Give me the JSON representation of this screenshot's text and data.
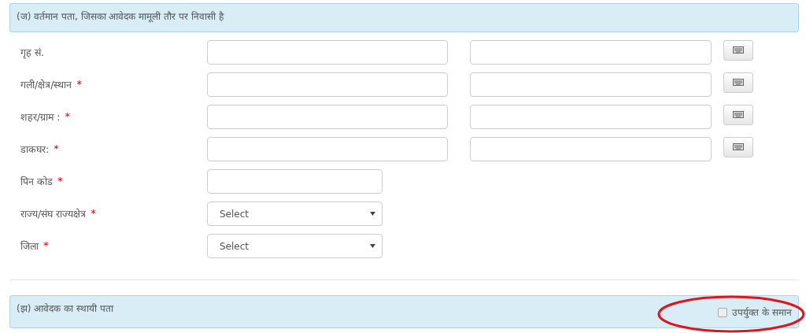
{
  "section_current": {
    "title": "(ज) वर्तमान पता, जिसका आवेदक मामूली तौर पर निवासी है"
  },
  "fields": [
    {
      "kind": "double",
      "label": "गृह सं."
    },
    {
      "kind": "double",
      "label": "गली/क्षेत्र/स्थान",
      "required_mark": "*"
    },
    {
      "kind": "double",
      "label": "शहर/ग्राम :",
      "required_mark": "*"
    },
    {
      "kind": "double",
      "label": "डाकघर:",
      "required_mark": "*"
    },
    {
      "kind": "single",
      "label": "पिन कोड",
      "required_mark": "*"
    },
    {
      "kind": "select",
      "label": "राज्य/संघ राज्यक्षेत्र",
      "required_mark": "*",
      "value": "Select"
    },
    {
      "kind": "select",
      "label": "जिला",
      "required_mark": "*",
      "value": "Select"
    }
  ],
  "section_permanent": {
    "title": "(झ) आवेदक का स्थायी पता",
    "same_as_above": {
      "label": "उपर्युक्त के समान",
      "checked": false
    },
    "highlighted": true
  }
}
